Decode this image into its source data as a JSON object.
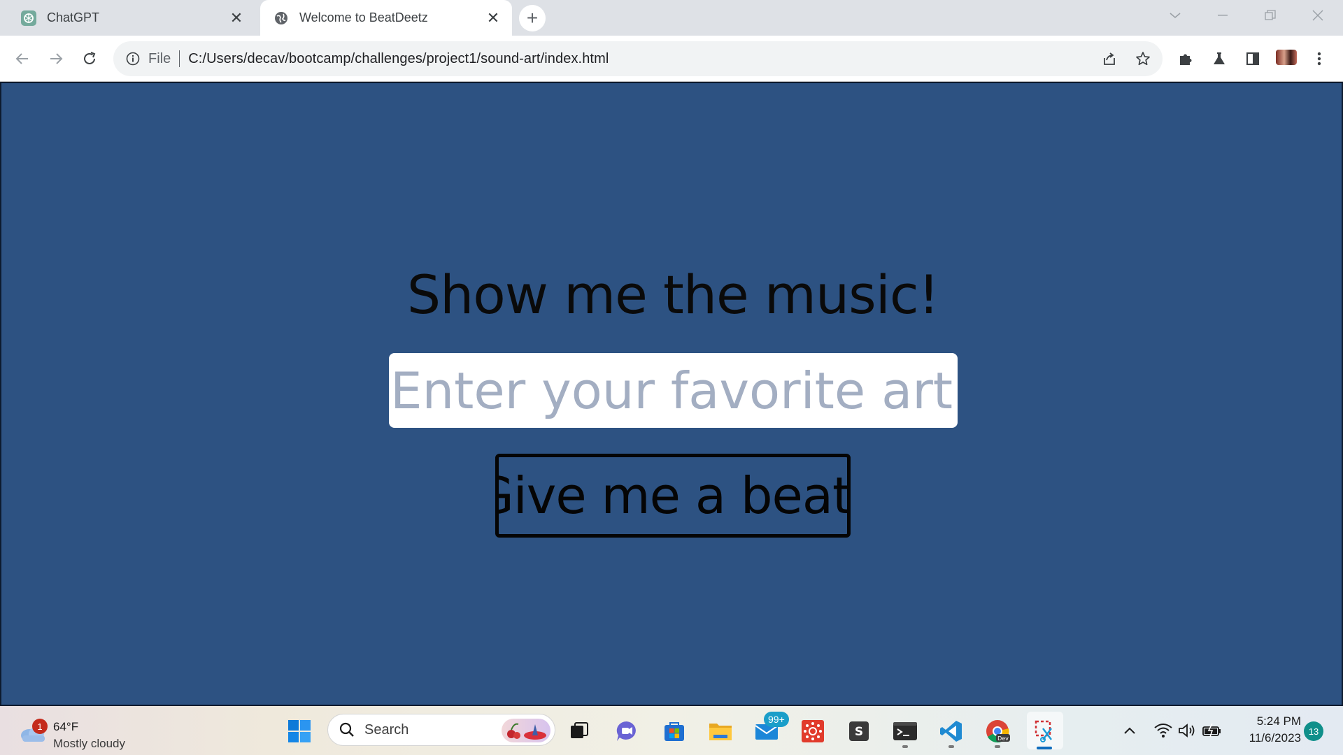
{
  "browser": {
    "tabs": [
      {
        "title": "ChatGPT",
        "favicon": "chatgpt-icon",
        "active": false
      },
      {
        "title": "Welcome to BeatDeetz",
        "favicon": "globe-icon",
        "active": true
      }
    ],
    "address": {
      "scheme_label": "File",
      "url": "C:/Users/decav/bootcamp/challenges/project1/sound-art/index.html"
    }
  },
  "page": {
    "headline": "Show me the music!",
    "artist_input_placeholder": "Enter your favorite artist!",
    "artist_input_value": "",
    "beat_button_label": "Give me a beat!",
    "colors": {
      "background": "#2d5282",
      "text": "#0a0a0a",
      "input_bg": "#ffffff",
      "placeholder": "#a3aec2"
    }
  },
  "taskbar": {
    "weather": {
      "badge": "1",
      "temp": "64°F",
      "condition": "Mostly cloudy"
    },
    "search_label": "Search",
    "mail_badge": "99+",
    "clock": {
      "time": "5:24 PM",
      "date": "11/6/2023"
    },
    "notification_count": "13"
  }
}
